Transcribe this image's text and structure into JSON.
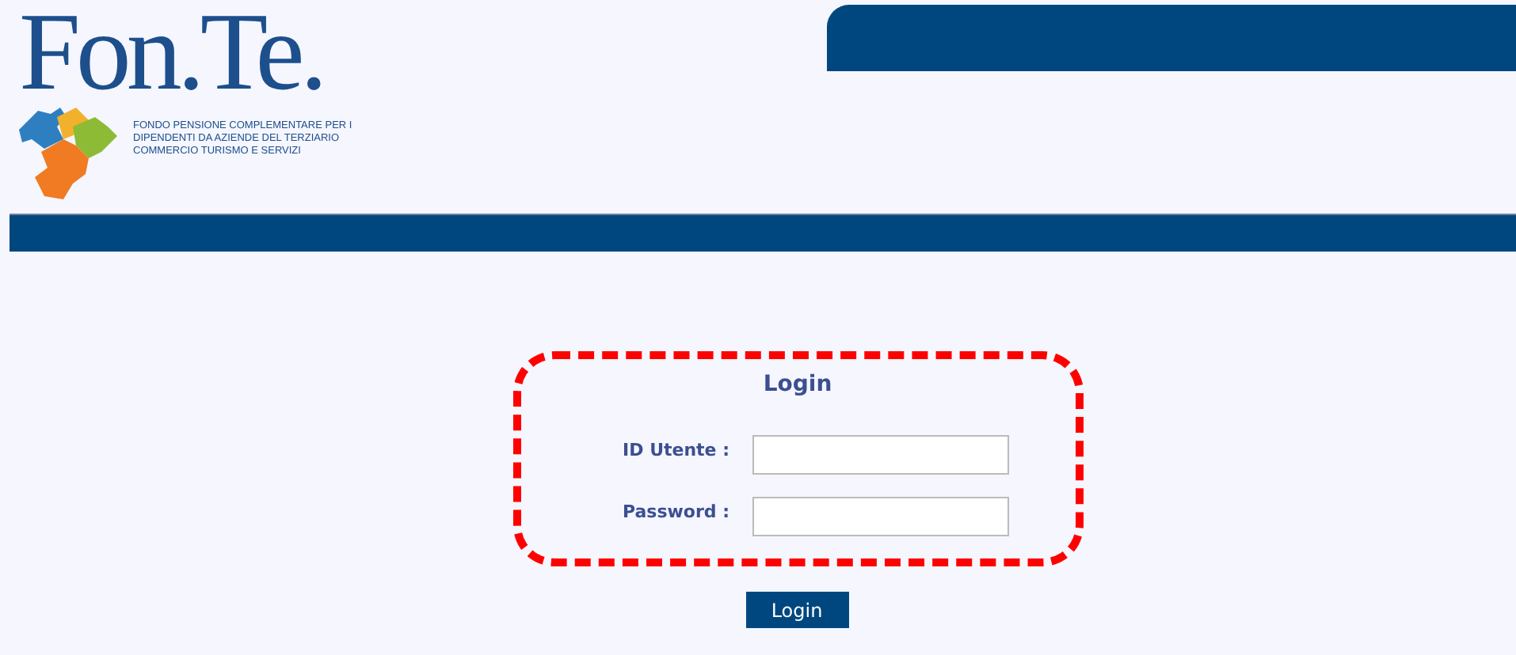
{
  "logo": {
    "name": "Fon.Te.",
    "tagline": [
      "FONDO PENSIONE COMPLEMENTARE PER I",
      "DIPENDENTI DA AZIENDE DEL TERZIARIO",
      "COMMERCIO TURISMO E SERVIZI"
    ]
  },
  "login": {
    "title": "Login",
    "fields": [
      {
        "label": "ID Utente :"
      },
      {
        "label": "Password :"
      }
    ],
    "button": "Login"
  }
}
